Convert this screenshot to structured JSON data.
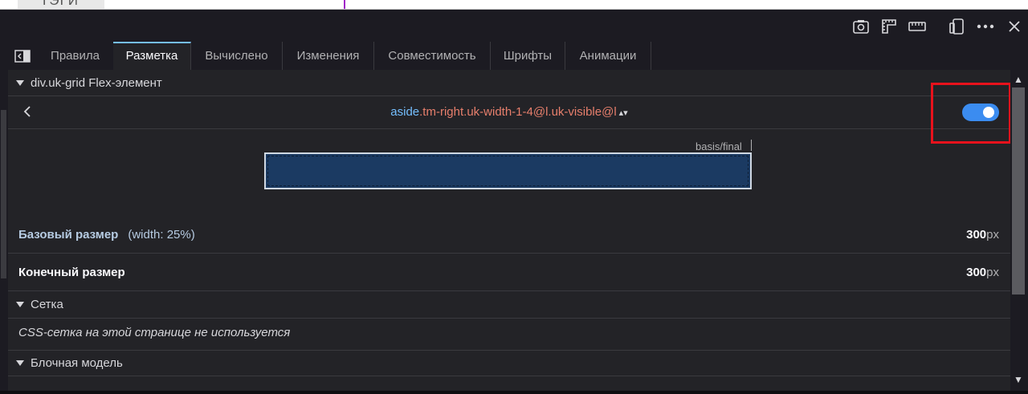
{
  "webpage": {
    "tag_text": "ТЭГИ"
  },
  "toolbar": {
    "icons": [
      "screenshot-icon",
      "rulers-icon",
      "measure-icon",
      "responsive-icon",
      "more-icon",
      "close-icon"
    ]
  },
  "tabs": [
    {
      "label": "Правила",
      "active": false
    },
    {
      "label": "Разметка",
      "active": true
    },
    {
      "label": "Вычислено",
      "active": false
    },
    {
      "label": "Изменения",
      "active": false
    },
    {
      "label": "Совместимость",
      "active": false
    },
    {
      "label": "Шрифты",
      "active": false
    },
    {
      "label": "Анимации",
      "active": false
    }
  ],
  "flex_section": {
    "title": "div.uk-grid Flex-элемент",
    "selector": {
      "tag": "aside",
      "classes": ".tm-right.uk-width-1-4@l.uk-visible@l",
      "arrows": "▴▾"
    },
    "toggle_on": true,
    "basis_label": "basis/final",
    "base_size": {
      "label": "Базовый размер",
      "note": "(width: 25%)",
      "value": "300",
      "unit": "px"
    },
    "final_size": {
      "label": "Конечный размер",
      "value": "300",
      "unit": "px"
    }
  },
  "grid_section": {
    "title": "Сетка",
    "note": "CSS-сетка на этой странице не используется"
  },
  "box_section": {
    "title": "Блочная модель"
  },
  "colors": {
    "accent": "#3b8cf0",
    "highlight": "#e8121c",
    "bar": "#1b3a62"
  }
}
